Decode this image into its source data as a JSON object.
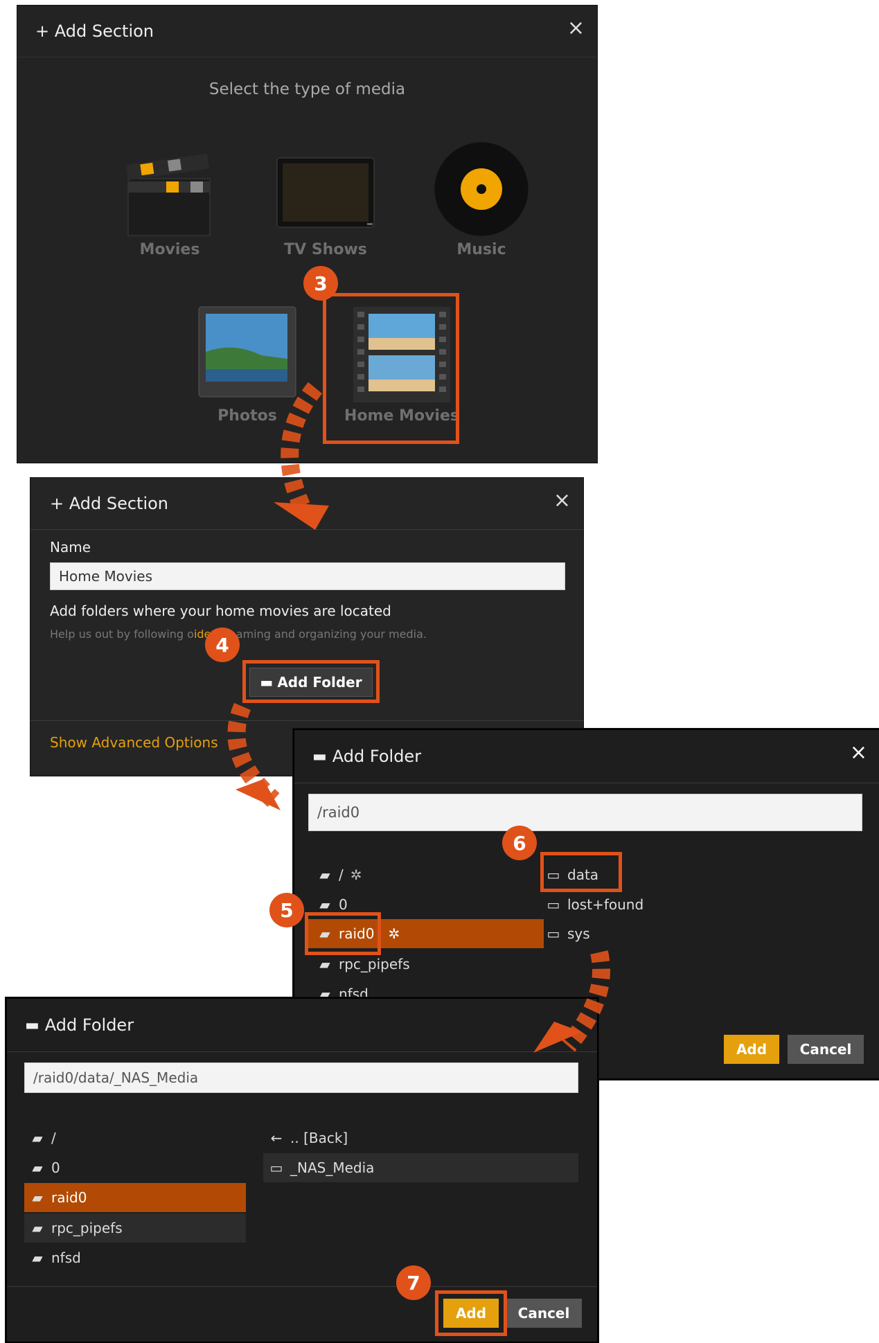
{
  "panel1": {
    "title": "+ Add Section",
    "close": "×",
    "subtitle": "Select the type of media",
    "media": [
      {
        "label": "Movies",
        "icon": "clapperboard-icon"
      },
      {
        "label": "TV Shows",
        "icon": "tv-icon"
      },
      {
        "label": "Music",
        "icon": "vinyl-record-icon"
      },
      {
        "label": "Photos",
        "icon": "photo-icon"
      },
      {
        "label": "Home Movies",
        "icon": "film-strip-icon"
      }
    ],
    "step": "3"
  },
  "panel2": {
    "title": "+ Add Section",
    "close": "×",
    "name_label": "Name",
    "name_value": "Home Movies",
    "folders_heading": "Add folders where your home movies are located",
    "help_prefix": "Help us out by following o",
    "help_link": "ide",
    "help_suffix": " to naming and organizing your media.",
    "add_folder_label": "Add Folder",
    "advanced_label": "Show Advanced Options",
    "step": "4"
  },
  "panel3": {
    "title": "Add Folder",
    "close": "×",
    "path": "/raid0",
    "left_items": [
      "/",
      "0",
      "raid0",
      "rpc_pipefs",
      "nfsd"
    ],
    "right_items": [
      "data",
      "lost+found",
      "sys"
    ],
    "add_label": "Add",
    "cancel_label": "Cancel",
    "step_left": "5",
    "step_right": "6"
  },
  "panel4": {
    "title": "Add Folder",
    "path": "/raid0/data/_NAS_Media",
    "left_items": [
      "/",
      "0",
      "raid0",
      "rpc_pipefs",
      "nfsd"
    ],
    "right_items": [
      ".. [Back]",
      "_NAS_Media"
    ],
    "add_label": "Add",
    "cancel_label": "Cancel",
    "step": "7"
  },
  "colors": {
    "accent": "#e0521a",
    "selected": "#b24a05",
    "plex_orange": "#e5a00d",
    "panel_bg": "#252525"
  }
}
